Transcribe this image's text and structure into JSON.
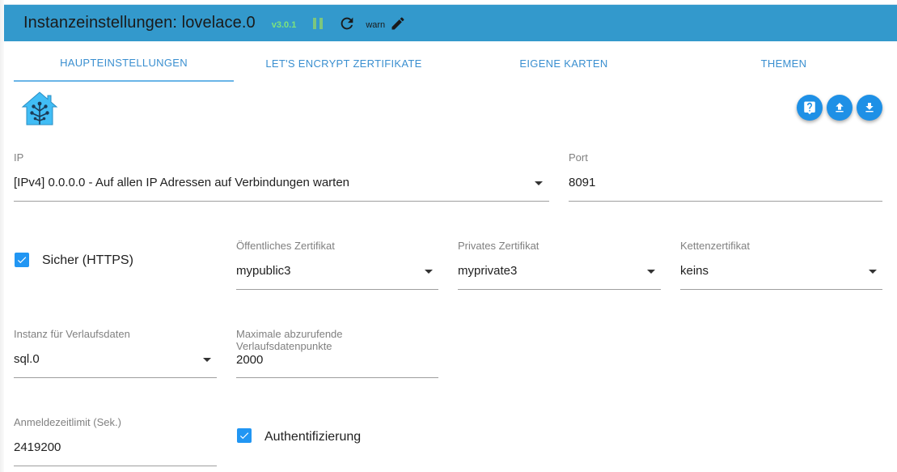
{
  "header": {
    "title": "Instanzeinstellungen: lovelace.0",
    "version": "v3.0.1",
    "log_level": "warn",
    "icons": [
      "pause-icon",
      "reload-icon",
      "edit-icon"
    ],
    "colors": {
      "header_bg": "#3399cc",
      "version": "#7de37d",
      "accent": "#2196f3"
    }
  },
  "tabs": [
    {
      "label": "HAUPTEINSTELLUNGEN",
      "active": true
    },
    {
      "label": "LET'S ENCRYPT ZERTIFIKATE",
      "active": false
    },
    {
      "label": "EIGENE KARTEN",
      "active": false
    },
    {
      "label": "THEMEN",
      "active": false
    }
  ],
  "toolbar": {
    "buttons": [
      "help-icon",
      "upload-icon",
      "download-icon"
    ]
  },
  "form": {
    "ip": {
      "label": "IP",
      "value": "[IPv4] 0.0.0.0 - Auf allen IP Adressen auf Verbindungen warten"
    },
    "port": {
      "label": "Port",
      "value": "8091"
    },
    "secure": {
      "label": "Sicher (HTTPS)",
      "checked": true
    },
    "public_cert": {
      "label": "Öffentliches Zertifikat",
      "value": "mypublic3"
    },
    "private_cert": {
      "label": "Privates Zertifikat",
      "value": "myprivate3"
    },
    "chain_cert": {
      "label": "Kettenzertifikat",
      "value": "keins"
    },
    "history_instance": {
      "label": "Instanz für Verlaufsdaten",
      "value": "sql.0"
    },
    "max_history": {
      "label_line1": "Maximale abzurufende",
      "label_line2": "Verlaufsdatenpunkte",
      "value": "2000"
    },
    "login_timeout": {
      "label": "Anmeldezeitlimit (Sek.)",
      "value": "2419200"
    },
    "auth": {
      "label": "Authentifizierung",
      "checked": true
    }
  }
}
